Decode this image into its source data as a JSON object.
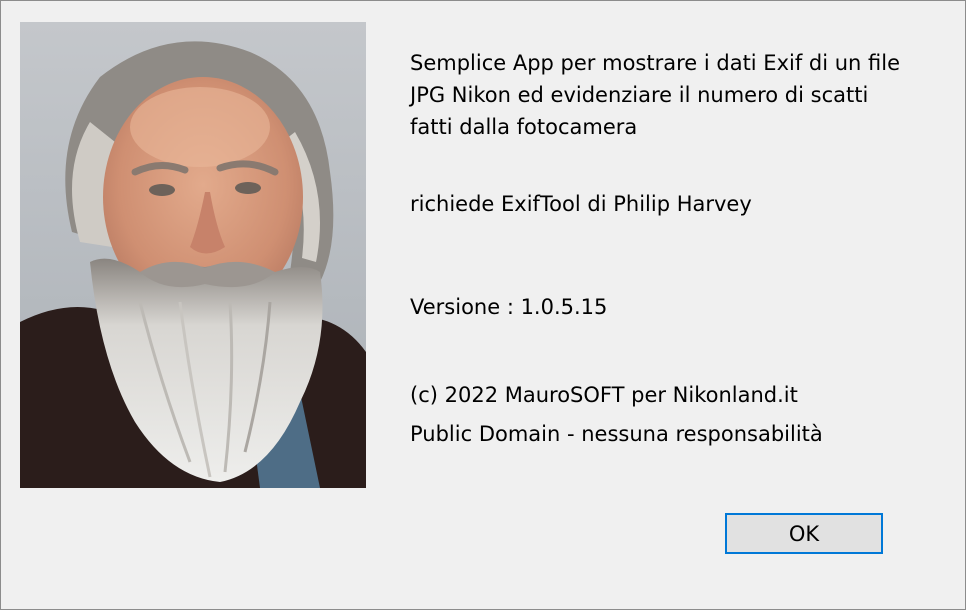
{
  "dialog": {
    "description_lines": [
      "Semplice App per mostrare i dati Exif di un file",
      "JPG Nikon ed evidenziare il numero di scatti",
      "fatti dalla fotocamera"
    ],
    "requirement": "richiede ExifTool di Philip Harvey",
    "version": "Versione : 1.0.5.15",
    "copyright": "(c) 2022 MauroSOFT per Nikonland.it",
    "license": "Public Domain - nessuna responsabilità",
    "ok_label": "OK"
  },
  "colors": {
    "background": "#f0f0f0",
    "button_border_focus": "#0078d7",
    "button_face": "#e1e1e1"
  }
}
